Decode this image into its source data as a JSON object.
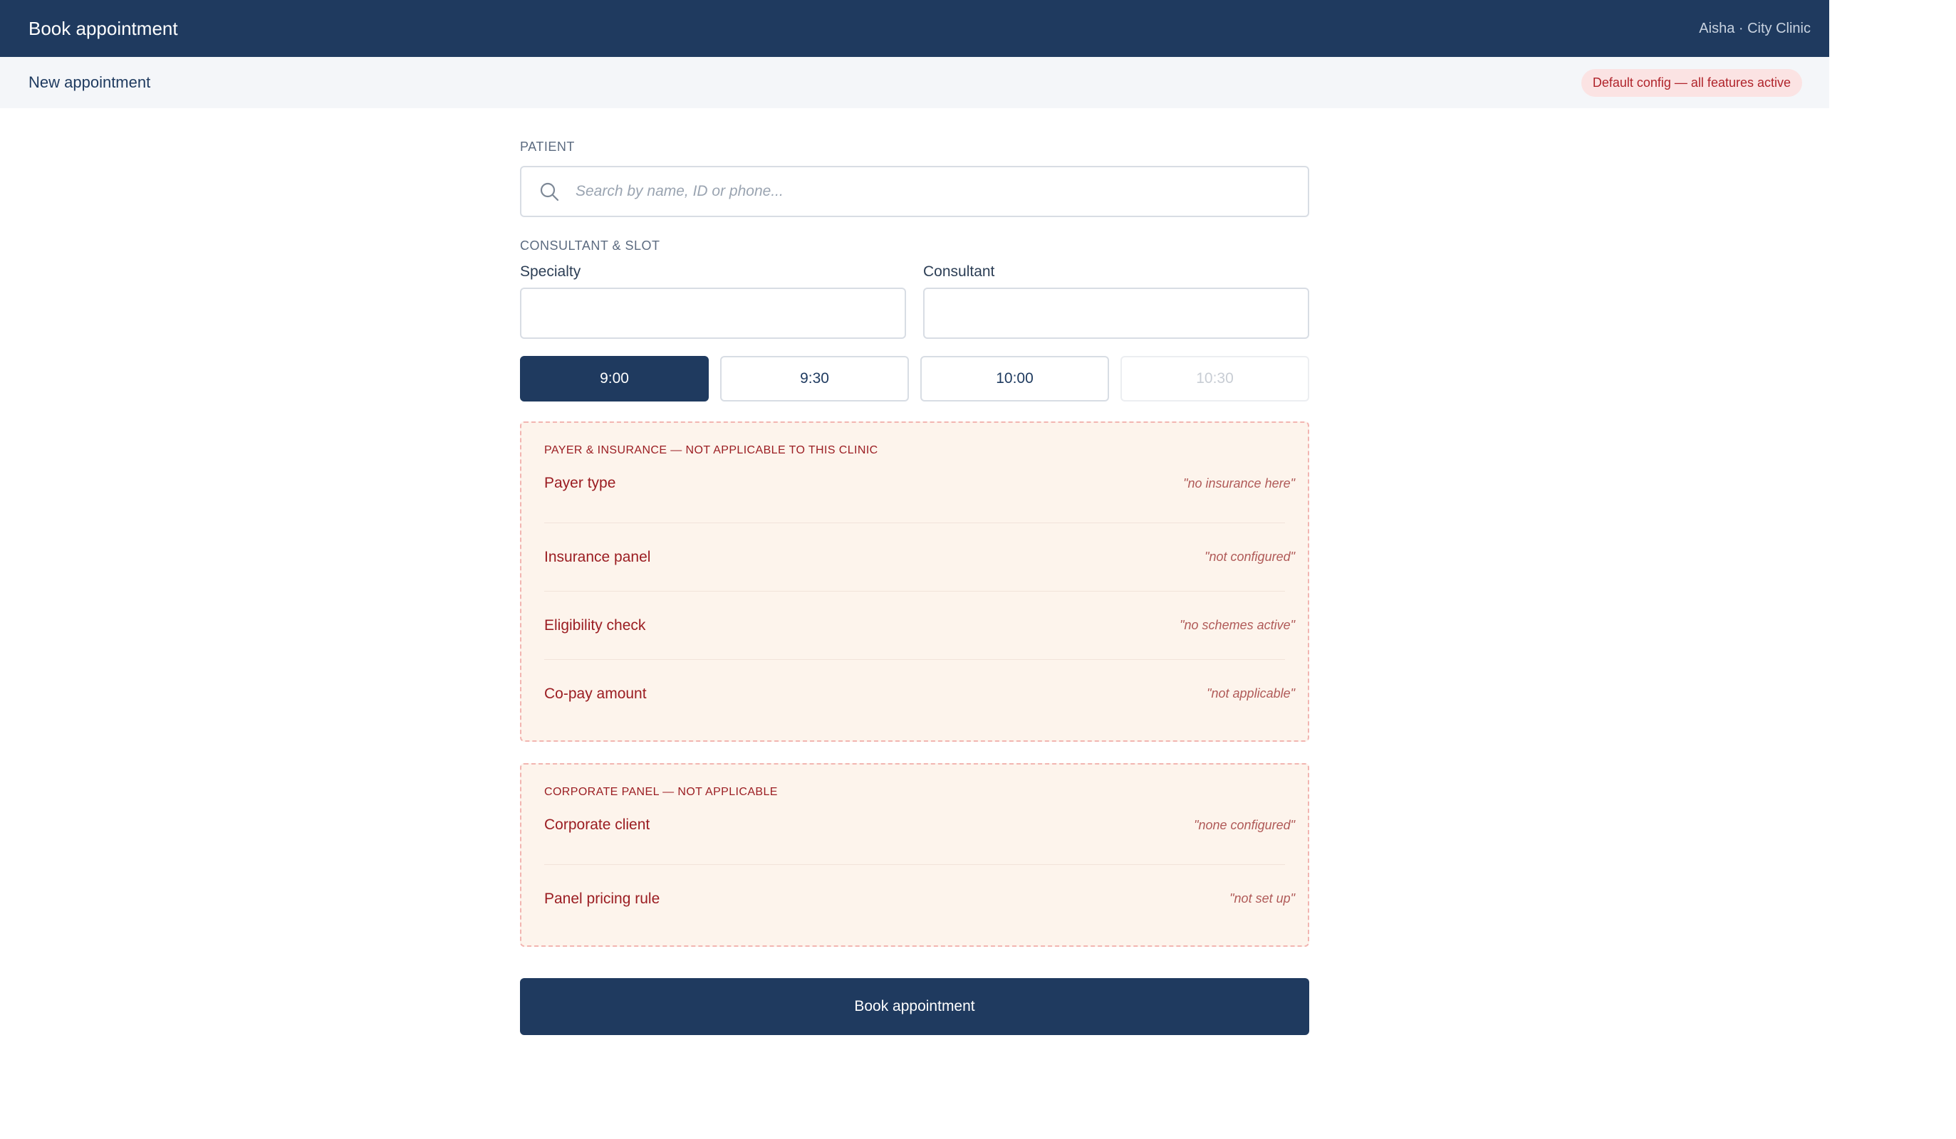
{
  "header": {
    "title": "Book appointment",
    "user": "Aisha · City Clinic"
  },
  "subheader": {
    "title": "New appointment",
    "badge": "Default config — all features active"
  },
  "patient": {
    "section_label": "PATIENT",
    "search_placeholder": "Search by name, ID or phone...",
    "search_value": "",
    "search_icon": "search-icon"
  },
  "consultant_slot": {
    "section_label": "CONSULTANT & SLOT",
    "specialty_label": "Specialty",
    "specialty_value": "",
    "consultant_label": "Consultant",
    "consultant_value": "",
    "slots": [
      {
        "label": "9:00",
        "state": "selected"
      },
      {
        "label": "9:30",
        "state": "available"
      },
      {
        "label": "10:00",
        "state": "available"
      },
      {
        "label": "10:30",
        "state": "disabled"
      }
    ]
  },
  "payer_panel": {
    "title": "PAYER & INSURANCE — NOT APPLICABLE TO THIS CLINIC",
    "rows": [
      {
        "label": "Payer type",
        "value": "\"no insurance here\""
      },
      {
        "label": "Insurance panel",
        "value": "\"not configured\""
      },
      {
        "label": "Eligibility check",
        "value": "\"no schemes active\""
      },
      {
        "label": "Co-pay amount",
        "value": "\"not applicable\""
      }
    ]
  },
  "corporate_panel": {
    "title": "CORPORATE PANEL — NOT APPLICABLE",
    "rows": [
      {
        "label": "Corporate client",
        "value": "\"none configured\""
      },
      {
        "label": "Panel pricing rule",
        "value": "\"not set up\""
      }
    ]
  },
  "actions": {
    "book_label": "Book appointment"
  },
  "colors": {
    "primary": "#1f3a5f",
    "warning_bg": "#fdf4ec",
    "warning_border": "#f2b5b1",
    "warning_text": "#9b1d22",
    "badge_bg": "#fbe3e3"
  }
}
